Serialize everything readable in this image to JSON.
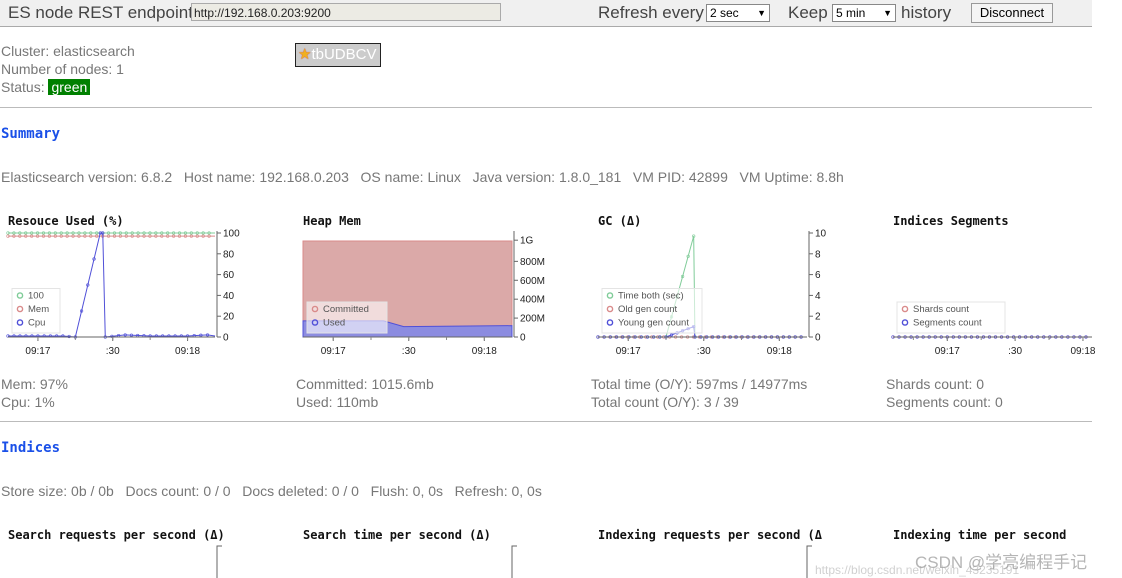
{
  "topbar": {
    "endpoint_label": "ES node REST endpoint",
    "endpoint_value": "http://192.168.0.203:9200",
    "refresh_label": "Refresh every",
    "refresh_value": "2 sec",
    "keep_label": "Keep",
    "keep_value": "5 min",
    "history_label": "history",
    "disconnect_label": "Disconnect"
  },
  "cluster": {
    "cluster_line": "Cluster: elasticsearch",
    "nodes_line": "Number of nodes: 1",
    "status_label": "Status:",
    "status_value": "green",
    "status_color": "#008000",
    "node_name": "tbUDBCV",
    "node_icon": "star-medal-icon"
  },
  "summary": {
    "heading": "Summary",
    "info_line": "Elasticsearch version: 6.8.2   Host name: 192.168.0.203   OS name: Linux   Java version: 1.8.0_181   VM PID: 42899   VM Uptime: 8.8h",
    "resource_stats": [
      "Mem: 97%",
      "Cpu: 1%"
    ],
    "heap_stats": [
      "Committed: 1015.6mb",
      "Used: 110mb"
    ],
    "gc_stats": [
      "Total time (O/Y): 597ms / 14977ms",
      "Total count (O/Y): 3 / 39"
    ],
    "segments_stats": [
      "Shards count: 0",
      "Segments count: 0"
    ]
  },
  "indices": {
    "heading": "Indices",
    "info_line": "Store size: 0b / 0b   Docs count: 0 / 0   Docs deleted: 0 / 0   Flush: 0, 0s   Refresh: 0, 0s",
    "chart_titles": [
      "Search requests per second (Δ)",
      "Search time per second (Δ)",
      "Indexing requests per second (Δ",
      "Indexing time per second"
    ]
  },
  "watermark": {
    "line1": "CSDN @学亮编程手记",
    "line2": "https://blog.csdn.net/weixin_43235191"
  },
  "colors": {
    "green": "#80cc99",
    "red": "#d98a8a",
    "blue": "#5050d8",
    "committed_fill": "#dba9a8",
    "used_fill": "#8c8ce0",
    "section": "#1a50e8"
  },
  "chart_data": [
    {
      "type": "line",
      "title": "Resouce Used (%)",
      "xrange": [
        "09:16:48",
        "09:18:11"
      ],
      "xticks": [
        "09:17",
        ":30",
        "09:18"
      ],
      "ylim": [
        0,
        100
      ],
      "yticks": [
        "0",
        "20",
        "40",
        "60",
        "80",
        "100"
      ],
      "ytick_values": [
        0,
        20,
        40,
        60,
        80,
        100
      ],
      "legend": "bottom-left",
      "series": [
        {
          "name": "100",
          "color": "green",
          "points": [
            [
              "09:16:48",
              100
            ],
            [
              "09:18:11",
              100
            ]
          ]
        },
        {
          "name": "Mem",
          "color": "red",
          "points": [
            [
              "09:16:48",
              97
            ],
            [
              "09:18:11",
              97
            ]
          ]
        },
        {
          "name": "Cpu",
          "color": "blue",
          "points": [
            [
              "09:16:48",
              1
            ],
            [
              "09:17:00",
              1
            ],
            [
              "09:17:10",
              1
            ],
            [
              "09:17:15",
              0
            ],
            [
              "09:17:25",
              100
            ],
            [
              "09:17:26",
              100
            ],
            [
              "09:17:27",
              0
            ],
            [
              "09:17:35",
              2
            ],
            [
              "09:17:45",
              1
            ],
            [
              "09:18:00",
              1
            ],
            [
              "09:18:08",
              2
            ],
            [
              "09:18:11",
              1
            ]
          ]
        }
      ]
    },
    {
      "type": "area",
      "title": "Heap Mem",
      "xrange": [
        "09:16:48",
        "09:18:11"
      ],
      "xticks": [
        "09:17",
        ":30",
        "09:18"
      ],
      "ylim": [
        0,
        1100
      ],
      "yticks": [
        "0",
        "200M",
        "400M",
        "600M",
        "800M",
        "1G"
      ],
      "ytick_values": [
        0,
        200,
        400,
        600,
        800,
        1024
      ],
      "legend": "bottom-left",
      "series": [
        {
          "name": "Committed",
          "color": "red",
          "points": [
            [
              "09:16:48",
              1015.6
            ],
            [
              "09:18:11",
              1015.6
            ]
          ]
        },
        {
          "name": "Used",
          "color": "blue",
          "points": [
            [
              "09:16:48",
              170
            ],
            [
              "09:17:20",
              170
            ],
            [
              "09:17:28",
              110
            ],
            [
              "09:18:11",
              120
            ]
          ]
        }
      ]
    },
    {
      "type": "line",
      "title": "GC (Δ)",
      "xrange": [
        "09:16:48",
        "09:18:11"
      ],
      "xticks": [
        "09:17",
        ":30",
        "09:18"
      ],
      "ylim": [
        0,
        10
      ],
      "yticks": [
        "0",
        "2",
        "4",
        "6",
        "8",
        "10"
      ],
      "ytick_values": [
        0,
        2,
        4,
        6,
        8,
        10
      ],
      "legend": "bottom-left",
      "series": [
        {
          "name": "Time both (sec)",
          "color": "green",
          "points": [
            [
              "09:16:48",
              0
            ],
            [
              "09:17:15",
              0
            ],
            [
              "09:17:26",
              9.7
            ],
            [
              "09:17:26.5",
              0
            ],
            [
              "09:18:11",
              0
            ]
          ]
        },
        {
          "name": "Old gen count",
          "color": "red",
          "points": [
            [
              "09:16:48",
              0
            ],
            [
              "09:18:11",
              0
            ]
          ]
        },
        {
          "name": "Young gen count",
          "color": "blue",
          "points": [
            [
              "09:16:48",
              0
            ],
            [
              "09:17:15",
              0
            ],
            [
              "09:17:26",
              1
            ],
            [
              "09:17:26.5",
              0
            ],
            [
              "09:18:11",
              0
            ]
          ]
        }
      ]
    },
    {
      "type": "line",
      "title": "Indices Segments",
      "xrange": [
        "09:16:36",
        "09:18:04"
      ],
      "xticks": [
        "09:17",
        ":30",
        "09:18"
      ],
      "ylim": [
        0,
        10
      ],
      "yticks": [],
      "ytick_values": [],
      "legend": "bottom-left",
      "series": [
        {
          "name": "Shards count",
          "color": "red",
          "points": [
            [
              "09:16:36",
              0
            ],
            [
              "09:18:04",
              0
            ]
          ]
        },
        {
          "name": "Segments count",
          "color": "blue",
          "points": [
            [
              "09:16:36",
              0
            ],
            [
              "09:18:04",
              0
            ]
          ]
        }
      ]
    }
  ]
}
